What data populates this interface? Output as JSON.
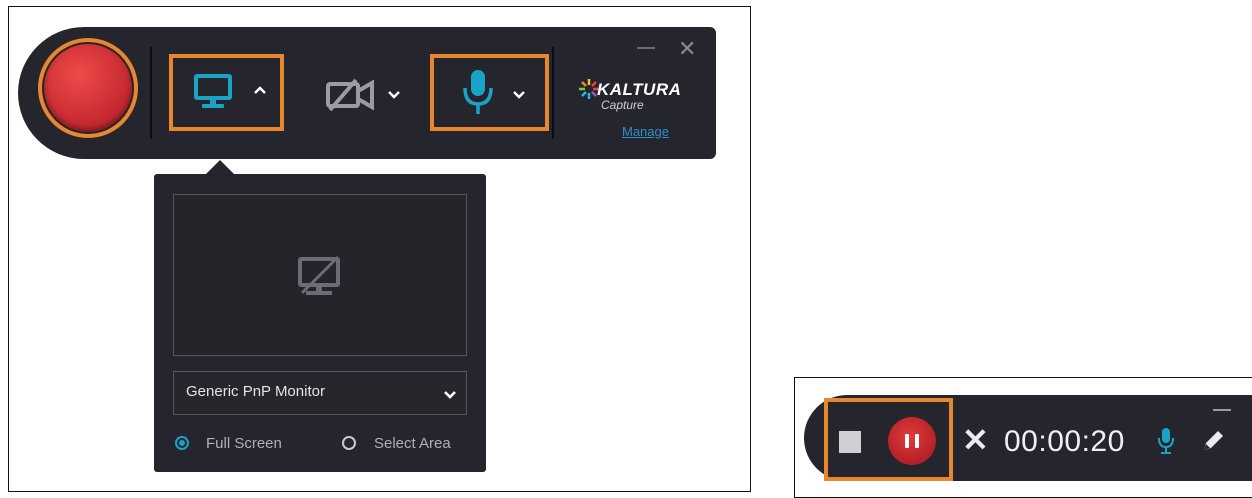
{
  "colors": {
    "toolbar_bg": "#25252d",
    "highlight": "#e8872f",
    "record_red": "#c1272d",
    "accent_teal": "#19a3c6",
    "link_blue": "#2f8fc8"
  },
  "toolbar": {
    "record_icon": "record-button",
    "screen_icon": "monitor-icon",
    "camera_icon": "camera-off-icon",
    "mic_icon": "microphone-icon",
    "brand_name": "KALTURA",
    "brand_sub": "Capture",
    "manage_label": "Manage",
    "minimize_icon": "minimize-icon",
    "close_icon": "close-icon"
  },
  "screen_panel": {
    "preview_icon": "monitor-off-icon",
    "monitor_select": "Generic PnP Monitor",
    "options": [
      {
        "label": "Full Screen",
        "selected": true
      },
      {
        "label": "Select Area",
        "selected": false
      }
    ]
  },
  "recording_bar": {
    "timer": "00:00:20",
    "stop_icon": "stop-icon",
    "pause_icon": "pause-icon",
    "cancel_icon": "close-icon",
    "mic_icon": "microphone-icon",
    "pen_icon": "pencil-icon"
  }
}
